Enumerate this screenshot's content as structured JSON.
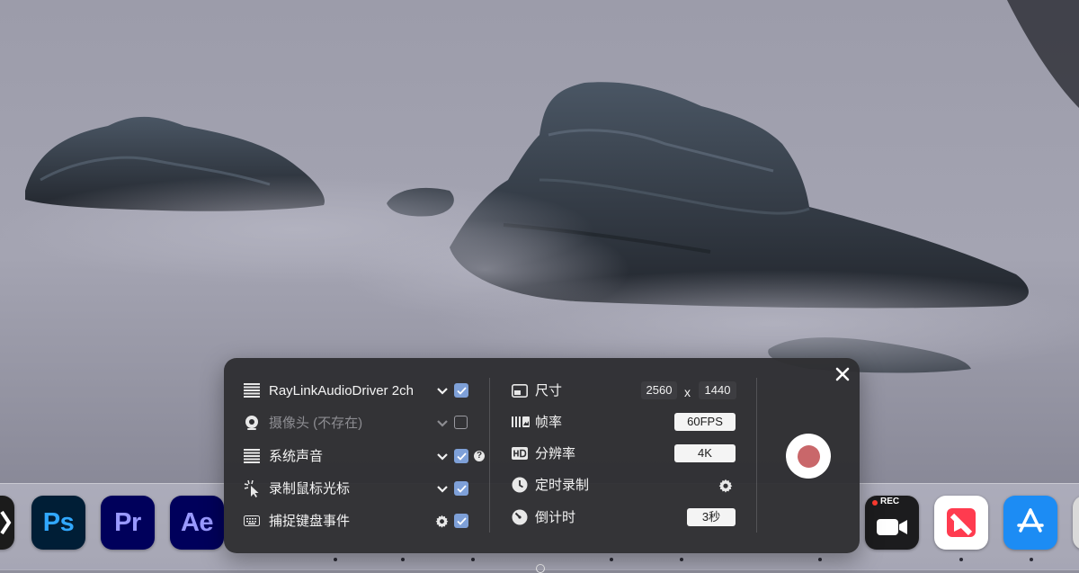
{
  "dock": {
    "apps": [
      {
        "name": "capcut",
        "abbr": "",
        "bg": "#1b1b1b",
        "fg": "#ffffff"
      },
      {
        "name": "photoshop",
        "abbr": "Ps",
        "bg": "#001e36",
        "fg": "#31a8ff"
      },
      {
        "name": "premiere-pro",
        "abbr": "Pr",
        "bg": "#00005b",
        "fg": "#9999ff"
      },
      {
        "name": "after-effects",
        "abbr": "Ae",
        "bg": "#00005b",
        "fg": "#9999ff"
      },
      {
        "name": "rec-camera",
        "abbr": "",
        "badge": "REC",
        "bg": "#1c1c1e",
        "fg": "#ffffff"
      },
      {
        "name": "news",
        "abbr": "",
        "bg": "#ffffff",
        "fg": "#ff3b4f"
      },
      {
        "name": "app-store",
        "abbr": "",
        "bg": "#1c8cf4",
        "fg": "#ffffff"
      }
    ]
  },
  "panel": {
    "left": [
      {
        "id": "audio-driver",
        "label": "RayLinkAudioDriver 2ch",
        "icon": "audio-bars-icon",
        "checked": true,
        "enabled": true
      },
      {
        "id": "camera",
        "label": "摄像头 (不存在)",
        "icon": "webcam-icon",
        "checked": false,
        "enabled": false
      },
      {
        "id": "system-audio",
        "label": "系统声音",
        "icon": "audio-bars-icon",
        "checked": true,
        "enabled": true
      },
      {
        "id": "record-cursor",
        "label": "录制鼠标光标",
        "icon": "cursor-click-icon",
        "checked": true,
        "enabled": true
      },
      {
        "id": "capture-keyboard",
        "label": "捕捉键盘事件",
        "icon": "keyboard-icon",
        "checked": true,
        "enabled": true
      }
    ],
    "right": {
      "size": {
        "label": "尺寸",
        "width": "2560",
        "sep": "x",
        "height": "1440"
      },
      "framerate": {
        "label": "帧率",
        "value": "60FPS"
      },
      "resolution": {
        "label": "分辨率",
        "value": "4K"
      },
      "timer": {
        "label": "定时录制"
      },
      "countdown": {
        "label": "倒计时",
        "value": "3秒"
      }
    },
    "help_glyph": "?",
    "record_color": "#c9676a",
    "checkbox_color": "#7ea0d8"
  }
}
